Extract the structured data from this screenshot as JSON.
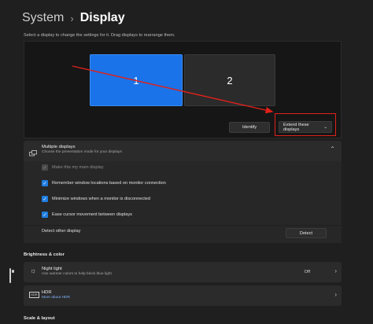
{
  "breadcrumb": {
    "parent": "System",
    "separator": "›",
    "current": "Display"
  },
  "arrange": {
    "description": "Select a display to change the settings for it. Drag displays to rearrange them.",
    "monitor_1": "1",
    "monitor_2": "2",
    "identify_label": "Identify",
    "mode_label": "Extend these displays",
    "mode_chevron": "⌄"
  },
  "multiple_displays": {
    "title": "Multiple displays",
    "subtitle": "Choose the presentation mode for your displays",
    "options": [
      {
        "label": "Make this my main display",
        "checked": true,
        "disabled": true
      },
      {
        "label": "Remember window locations based on monitor connection",
        "checked": true
      },
      {
        "label": "Minimize windows when a monitor is disconnected",
        "checked": true
      },
      {
        "label": "Ease cursor movement between displays",
        "checked": true
      }
    ],
    "detect_label": "Detect other display",
    "detect_button": "Detect"
  },
  "brightness": {
    "section_title": "Brightness & color",
    "night_light": {
      "title": "Night light",
      "subtitle": "Use warmer colors to help block blue light",
      "state": "Off"
    },
    "hdr": {
      "title": "HDR",
      "subtitle": "More about HDR"
    }
  },
  "scale_section_title": "Scale & layout",
  "colors": {
    "accent": "#1a73e8",
    "annotation": "#e0211a",
    "link": "#7fb4ff"
  }
}
